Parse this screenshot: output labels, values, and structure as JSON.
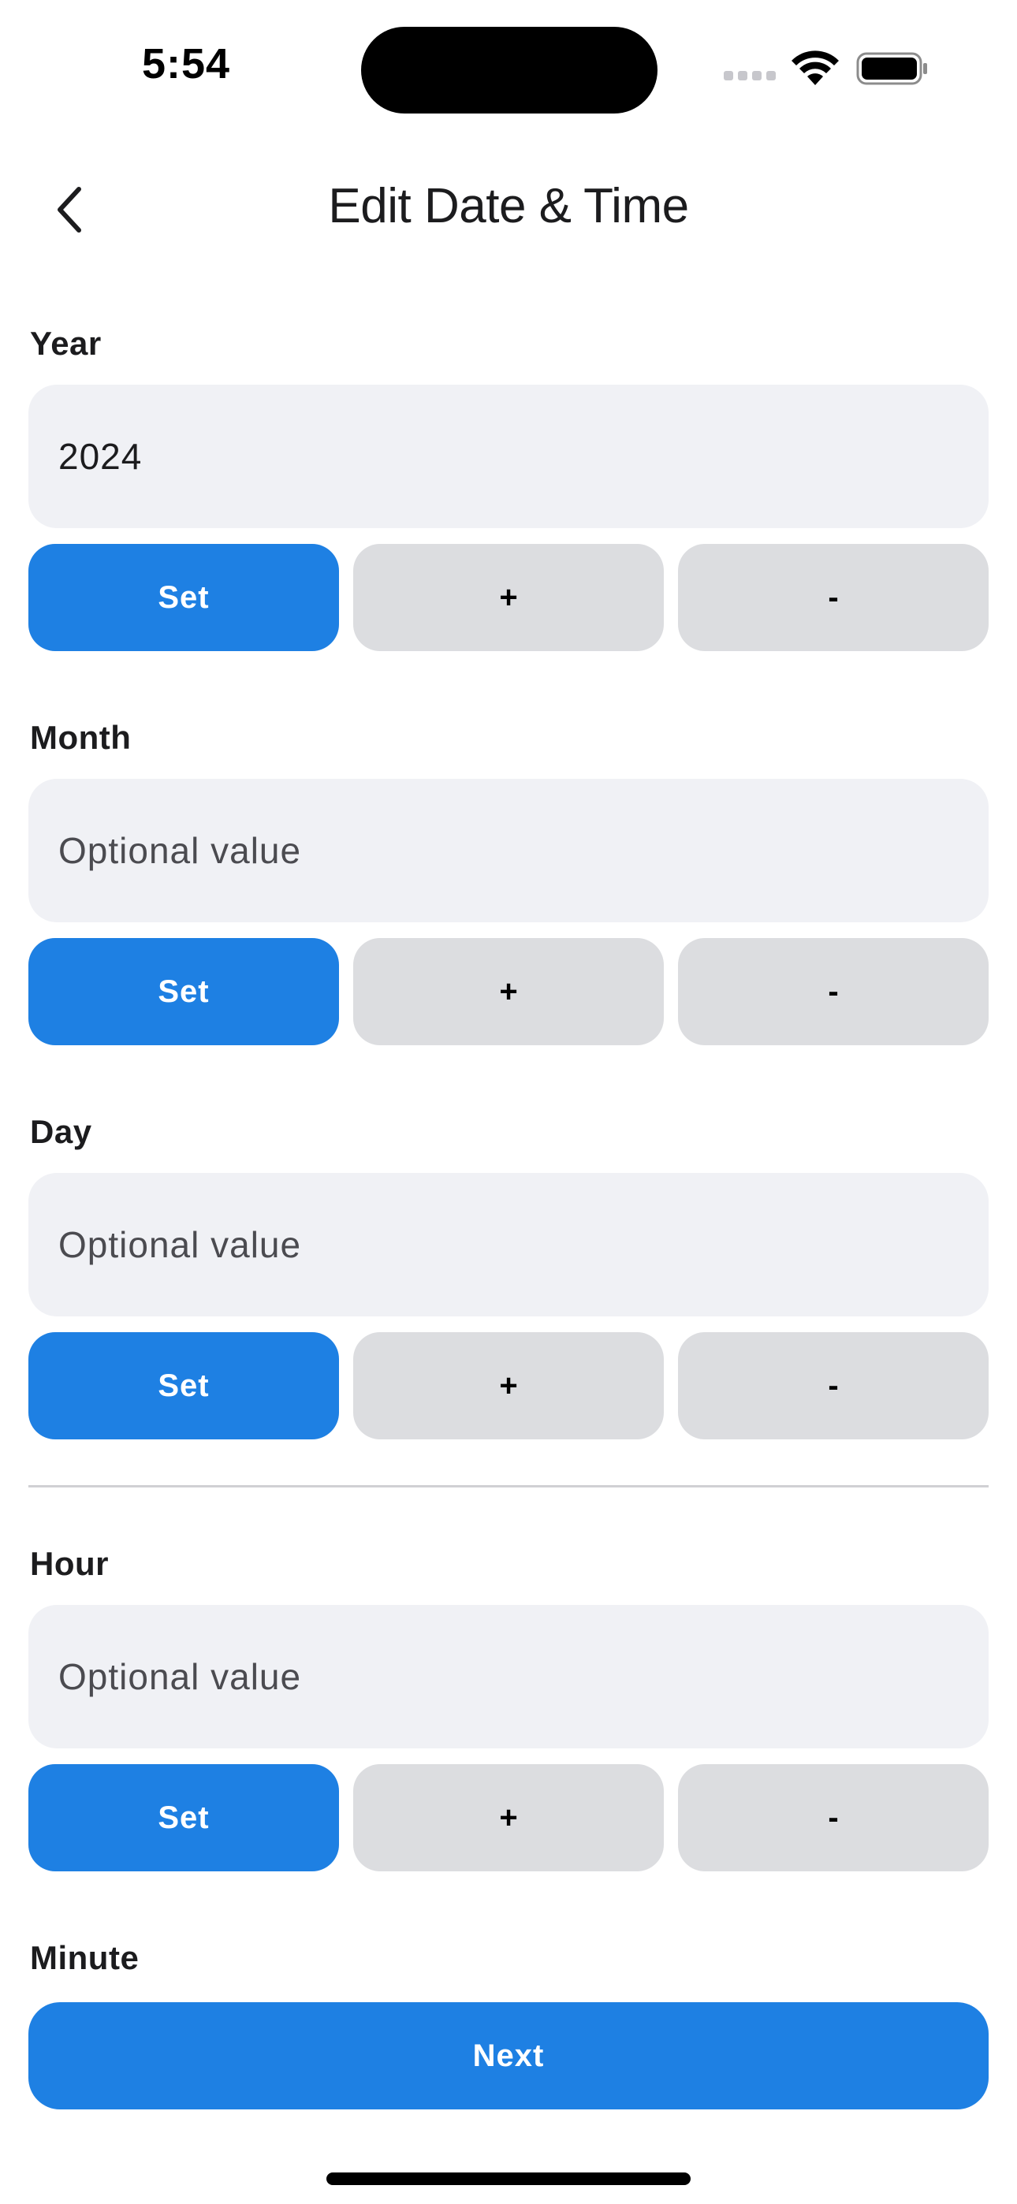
{
  "status_bar": {
    "time": "5:54"
  },
  "nav": {
    "title": "Edit Date & Time",
    "back_icon": "chevron-left-icon"
  },
  "fields": [
    {
      "label": "Year",
      "value": "2024",
      "placeholder": "Optional value",
      "set_label": "Set",
      "plus_label": "+",
      "minus_label": "-"
    },
    {
      "label": "Month",
      "value": "",
      "placeholder": "Optional value",
      "set_label": "Set",
      "plus_label": "+",
      "minus_label": "-"
    },
    {
      "label": "Day",
      "value": "",
      "placeholder": "Optional value",
      "set_label": "Set",
      "plus_label": "+",
      "minus_label": "-"
    },
    {
      "label": "Hour",
      "value": "",
      "placeholder": "Optional value",
      "set_label": "Set",
      "plus_label": "+",
      "minus_label": "-"
    },
    {
      "label": "Minute"
    }
  ],
  "next_label": "Next",
  "colors": {
    "accent": "#1e80e3",
    "input_bg": "#f0f1f5",
    "secondary_button_bg": "#dcdde0"
  }
}
